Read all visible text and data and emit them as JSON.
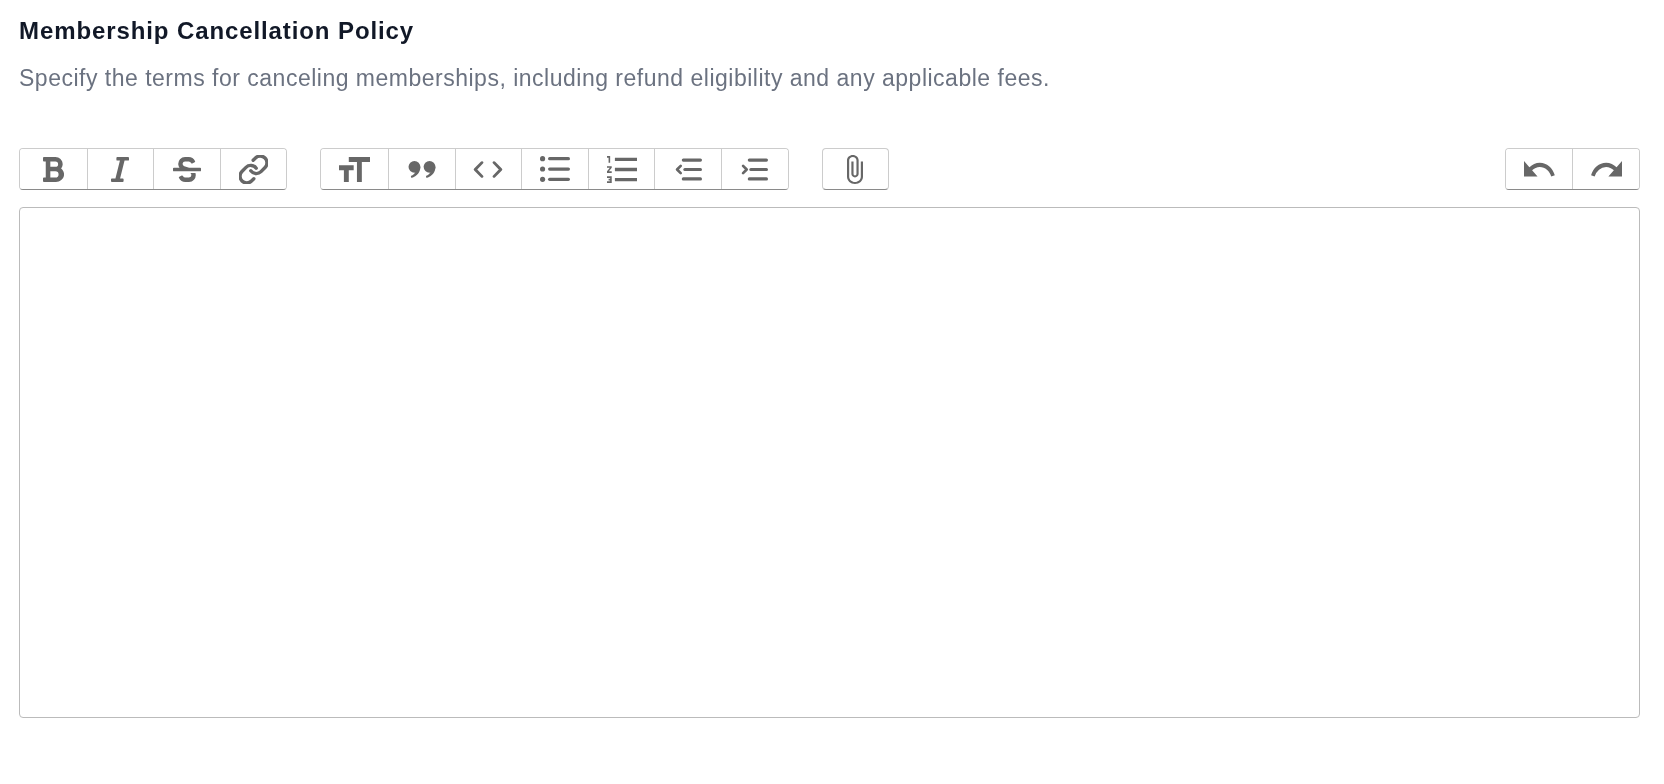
{
  "title": "Membership Cancellation Policy",
  "description": "Specify the terms for canceling memberships, including refund eligibility and any applicable fees.",
  "toolbar": {
    "groups": [
      {
        "kind": "text",
        "buttons": [
          {
            "kind": "bold"
          },
          {
            "kind": "italic"
          },
          {
            "kind": "strike"
          },
          {
            "kind": "link"
          }
        ]
      },
      {
        "kind": "block",
        "buttons": [
          {
            "kind": "heading"
          },
          {
            "kind": "quote"
          },
          {
            "kind": "code"
          },
          {
            "kind": "bullets"
          },
          {
            "kind": "numbers"
          },
          {
            "kind": "outdent"
          },
          {
            "kind": "indent"
          }
        ]
      },
      {
        "kind": "file",
        "buttons": [
          {
            "kind": "attach"
          }
        ]
      },
      {
        "kind": "history",
        "buttons": [
          {
            "kind": "undo"
          },
          {
            "kind": "redo"
          }
        ]
      }
    ]
  }
}
